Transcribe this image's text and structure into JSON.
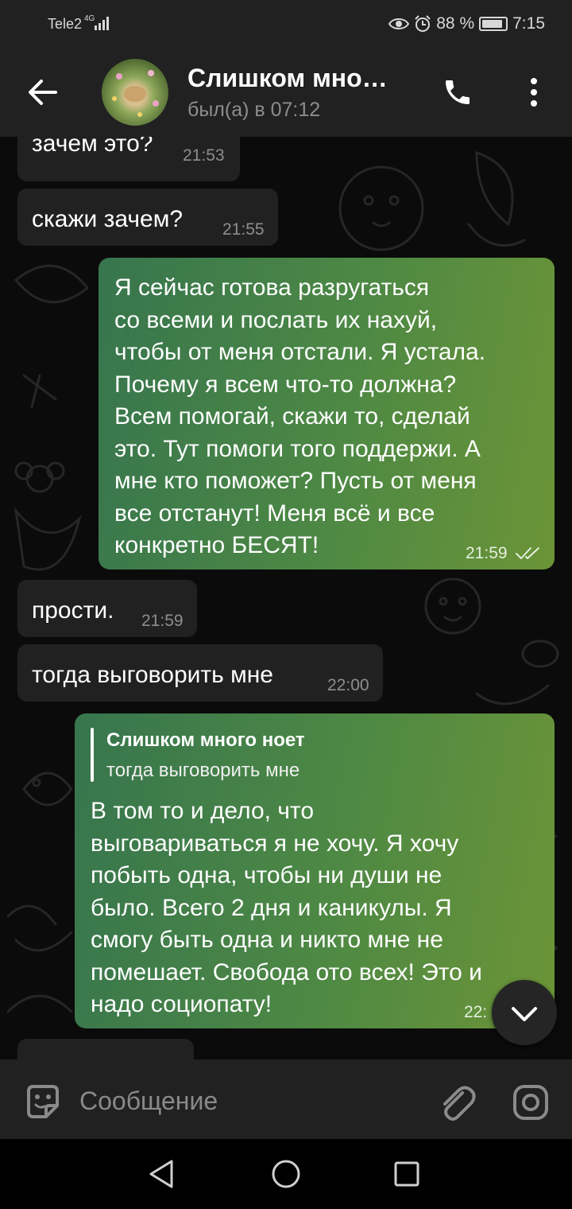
{
  "status_bar": {
    "carrier": "Tele2",
    "network": "4G",
    "battery_percent": "88 %",
    "battery_level": 0.88,
    "time": "7:15"
  },
  "header": {
    "title": "Слишком мно…",
    "subtitle": "был(а) в 07:12",
    "icons": [
      "arrow-left-icon",
      "phone-icon",
      "more-vertical-icon"
    ]
  },
  "messages": [
    {
      "direction": "in",
      "text": "зачем это?",
      "time": "21:53"
    },
    {
      "direction": "in",
      "text": "скажи зачем?",
      "time": "21:55"
    },
    {
      "direction": "out",
      "lines": [
        "Я сейчас готова разругаться",
        "со всеми и послать их нахуй,",
        "чтобы от меня отстали. Я устала.",
        "Почему я всем что-то должна?",
        "Всем помогай, скажи то, сделай",
        "это. Тут помоги того поддержи. А",
        "мне кто поможет? Пусть от меня",
        "все отстанут! Меня всё и все",
        "конкретно БЕСЯТ!"
      ],
      "time": "21:59",
      "status": "read"
    },
    {
      "direction": "in",
      "text": "прости.",
      "time": "21:59"
    },
    {
      "direction": "in",
      "text": "тогда выговорить мне",
      "time": "22:00"
    },
    {
      "direction": "out",
      "reply_to": {
        "name": "Слишком много ноет",
        "text": "тогда выговорить мне"
      },
      "lines": [
        "В том то и дело, что",
        "выговариваться я не хочу. Я хочу",
        "побыть одна, чтобы ни души не",
        "было. Всего 2 дня и каникулы. Я",
        "смогу быть одна и никто мне не",
        "помешает. Свобода ото всех! Это и",
        "надо социопату!"
      ],
      "time": "22:"
    }
  ],
  "composer": {
    "placeholder": "Сообщение",
    "icons": [
      "sticker-icon",
      "paperclip-icon",
      "camera-icon"
    ]
  },
  "scroll_down_icon": "chevron-down-icon",
  "navigation": [
    "nav-back-icon",
    "nav-home-icon",
    "nav-recents-icon"
  ],
  "colors": {
    "bar_background": "#212121",
    "chat_background": "#0b0b0b",
    "incoming_bubble": "#212121",
    "outgoing_bubble_start": "#37754e",
    "outgoing_bubble_end": "#6c9437",
    "muted_text": "#8d8d8d"
  }
}
